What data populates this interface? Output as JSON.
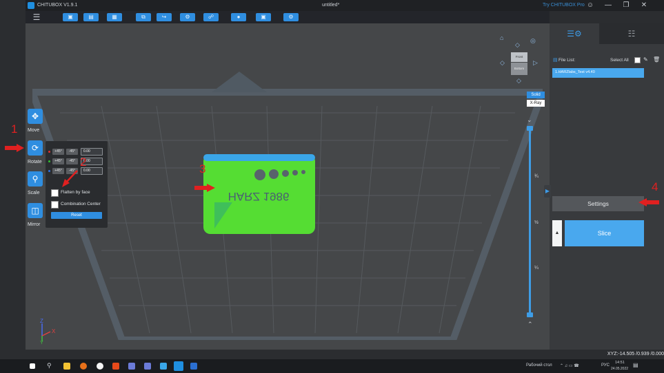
{
  "titlebar": {
    "app_name": "CHITUBOX V1.9.1",
    "document_title": "untitled*",
    "try_pro": "Try CHITUBOX Pro",
    "user_icon": "user-icon",
    "minimize_icon": "minimize-icon",
    "restore_icon": "restore-icon",
    "close_icon": "close-icon"
  },
  "toolbar": {
    "menu_icon": "hamburger-menu-icon",
    "buttons": [
      "open-file-icon",
      "save-icon",
      "import-icon",
      "copy-icon",
      "export-icon",
      "repair-icon",
      "tree-support-icon",
      "resin-icon",
      "hollow-icon",
      "machine-icon"
    ]
  },
  "left_tools": {
    "move": "Move",
    "rotate": "Rotate",
    "scale": "Scale",
    "mirror": "Mirror"
  },
  "rotate_panel": {
    "rows": [
      {
        "axis": "x",
        "color": "#e03030",
        "plus": "+45°",
        "minus": "-45°",
        "value": "0.00"
      },
      {
        "axis": "y",
        "color": "#30c030",
        "plus": "+45°",
        "minus": "-45°",
        "value": "0.00"
      },
      {
        "axis": "z",
        "color": "#3070e0",
        "plus": "+45°",
        "minus": "-45°",
        "value": "0.00"
      }
    ],
    "flatten_label": "Flatten by face",
    "combination_label": "Combination Center",
    "reset_label": "Reset"
  },
  "view": {
    "cube_front": "Front",
    "cube_bottom": "Bottom",
    "solid": "Solid",
    "xray": "X-Ray"
  },
  "model": {
    "text": "HARZ 1986"
  },
  "layer_slider": {
    "marks": [
      "¾",
      "½",
      "¼"
    ]
  },
  "right_panel": {
    "tab_file_icon": "file-settings-icon",
    "tab_support_icon": "supports-icon",
    "file_list_label": "File List:",
    "select_all_label": "Select All",
    "file_item": "1.HARZlabs_Test v4.40",
    "settings_label": "Settings",
    "slice_label": "Slice",
    "slice_expand": "▲"
  },
  "status": {
    "xyz": "XYZ:-14.505 /0.939 /0.000"
  },
  "taskbar": {
    "desktop_label": "Рабочий стол",
    "lang": "РУС",
    "time": "14:51",
    "date": "24.05.2022"
  },
  "annotations": {
    "n1": "1",
    "n2": "2",
    "n3": "3",
    "n4": "4"
  },
  "colors": {
    "accent": "#2f8ee0",
    "model_green": "#55dd33",
    "annotation_red": "#e02020"
  }
}
